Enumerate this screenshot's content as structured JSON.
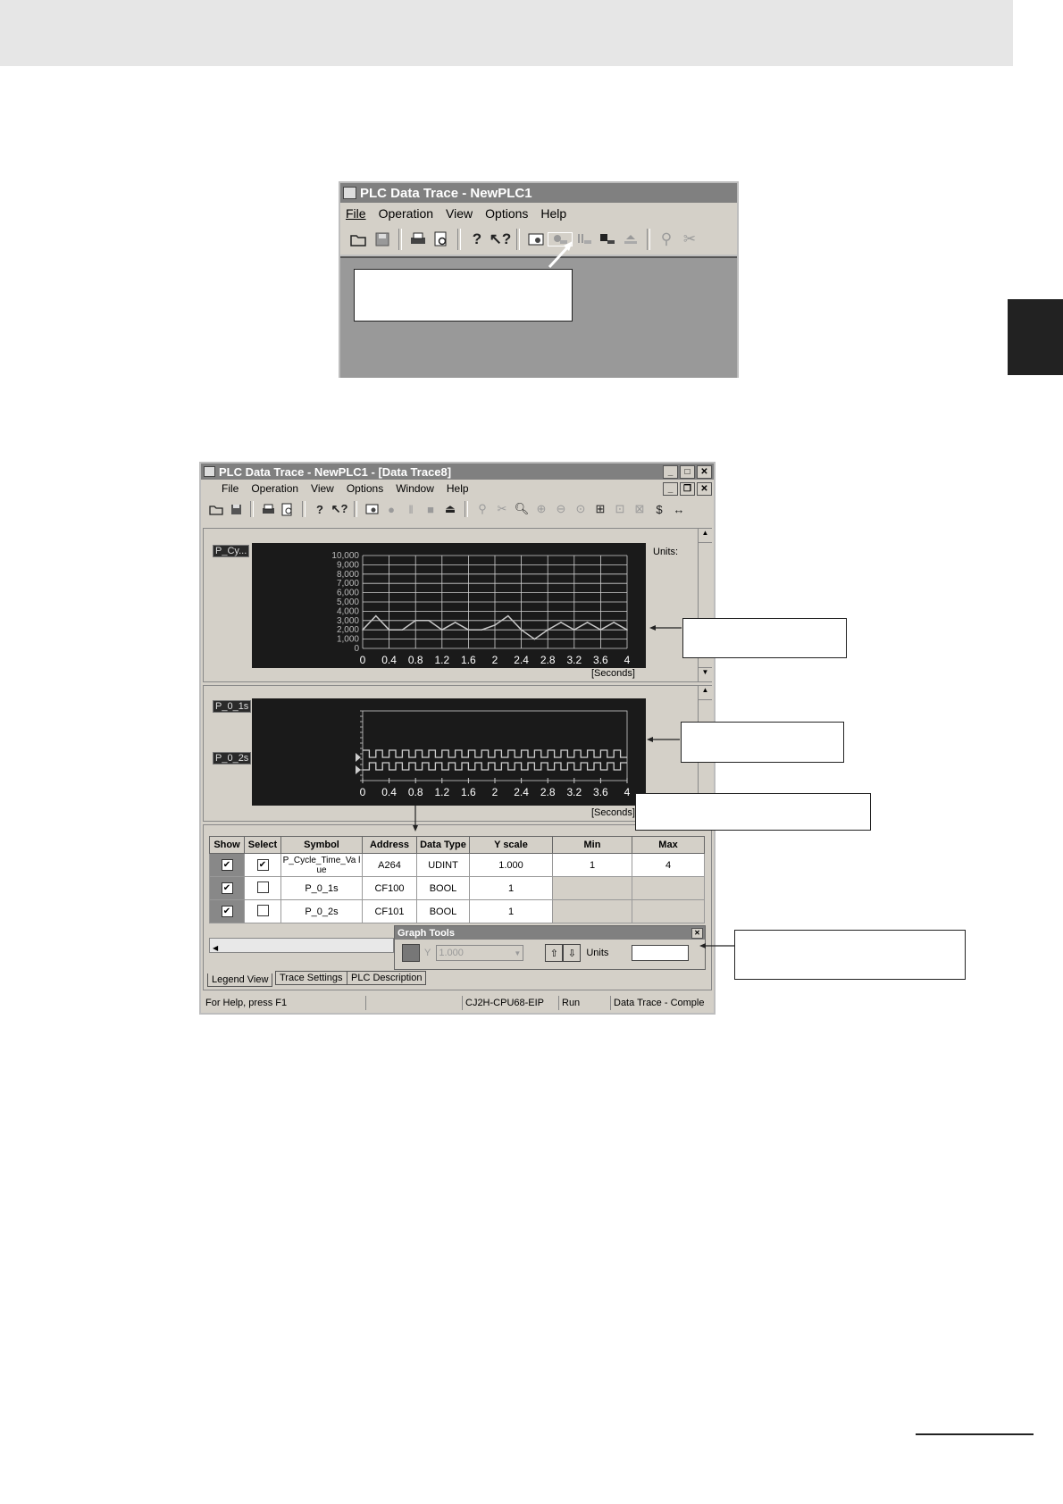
{
  "top_window": {
    "title": "PLC Data Trace - NewPLC1",
    "menu": [
      "File",
      "Operation",
      "View",
      "Options",
      "Help"
    ]
  },
  "main_window": {
    "title": "PLC Data Trace - NewPLC1 - [Data Trace8]",
    "menu": [
      "File",
      "Operation",
      "View",
      "Options",
      "Window",
      "Help"
    ],
    "toolbar_glyphs": {
      "dollar": "$",
      "arrows": "↔"
    },
    "analog_chart": {
      "channel_chip": "P_Cy...",
      "units_label": "Units:",
      "seconds_label": "[Seconds]"
    },
    "digital_chart": {
      "chips": [
        "P_0_1s",
        "P_0_2s"
      ],
      "seconds_label": "[Seconds]"
    },
    "legend": {
      "headers": [
        "Show",
        "Select",
        "Symbol",
        "Address",
        "Data Type",
        "Y scale",
        "Min",
        "Max"
      ],
      "rows": [
        {
          "show": "✔",
          "select": "✔",
          "symbol": "P_Cycle_Time_Va lue",
          "address": "A264",
          "data_type": "UDINT",
          "yscale": "1.000",
          "min": "1",
          "max": "4"
        },
        {
          "show": "✔",
          "select": "",
          "symbol": "P_0_1s",
          "address": "CF100",
          "data_type": "BOOL",
          "yscale": "1",
          "min": "",
          "max": ""
        },
        {
          "show": "✔",
          "select": "",
          "symbol": "P_0_2s",
          "address": "CF101",
          "data_type": "BOOL",
          "yscale": "1",
          "min": "",
          "max": ""
        }
      ]
    },
    "graph_tools": {
      "title": "Graph Tools",
      "y_label": "Y",
      "y_value": "1.000",
      "units_label": "Units"
    },
    "tabs": [
      "Legend View",
      "Trace Settings",
      "PLC Description"
    ],
    "status_bar": [
      "For Help, press F1",
      "",
      "CJ2H-CPU68-EIP",
      "Run",
      "Data Trace - Comple"
    ]
  },
  "chart_data": [
    {
      "type": "line",
      "x": [
        0,
        0.2,
        0.4,
        0.6,
        0.8,
        1.0,
        1.2,
        1.4,
        1.6,
        1.8,
        2.0,
        2.2,
        2.4,
        2.6,
        2.8,
        3.0,
        3.2,
        3.4,
        3.6,
        3.8,
        4.0
      ],
      "series": [
        {
          "values": [
            2000,
            3500,
            2000,
            2000,
            3000,
            3000,
            2000,
            2800,
            2000,
            2000,
            2500,
            3500,
            2000,
            1000,
            2000,
            2800,
            2000,
            2800,
            2000,
            2800,
            2000
          ]
        }
      ],
      "xlabel": "[Seconds]",
      "ylabel": "Units:",
      "xticks": [
        "0",
        "0.4",
        "0.8",
        "1.2",
        "1.6",
        "2",
        "2.4",
        "2.8",
        "3.2",
        "3.6",
        "4"
      ],
      "yticks": [
        "0",
        "1,000",
        "2,000",
        "3,000",
        "4,000",
        "5,000",
        "6,000",
        "7,000",
        "8,000",
        "9,000",
        "10,000"
      ],
      "xlim": [
        0,
        4
      ],
      "ylim": [
        0,
        10000
      ],
      "grid": true,
      "colors": {
        "background": "#1a1a1a",
        "line": "#c8c8c8",
        "grid": "#d0d0d0"
      }
    },
    {
      "type": "line",
      "x": [
        0,
        4
      ],
      "series": [
        {
          "name": "P_0_1s",
          "period_s": 0.2,
          "high": 1,
          "low": 0
        },
        {
          "name": "P_0_2s",
          "period_s": 0.2,
          "high": 1,
          "low": 0
        }
      ],
      "xlabel": "[Seconds]",
      "xticks": [
        "0",
        "0.4",
        "0.8",
        "1.2",
        "1.6",
        "2",
        "2.4",
        "2.8",
        "3.2",
        "3.6",
        "4"
      ],
      "xlim": [
        0,
        4
      ],
      "colors": {
        "background": "#1a1a1a",
        "signal": "#d0d0d0"
      }
    }
  ]
}
